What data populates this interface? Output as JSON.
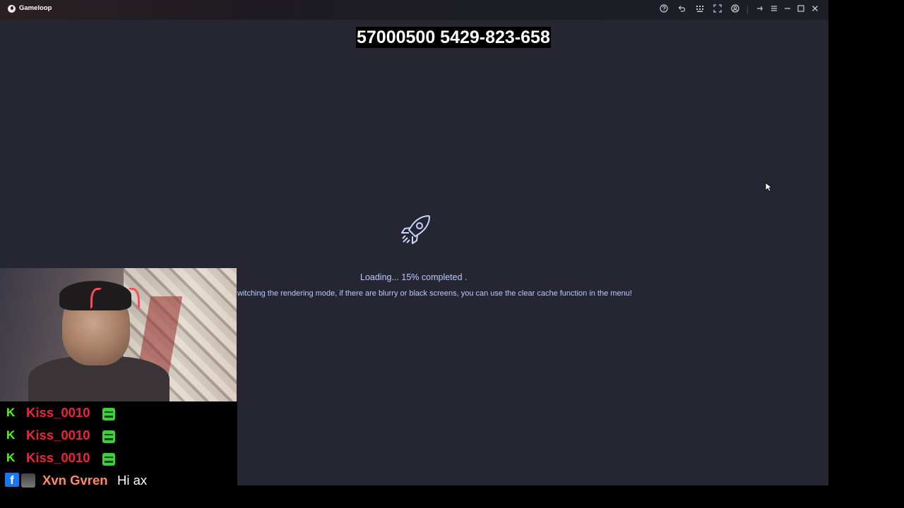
{
  "window": {
    "title": "Gameloop",
    "toolbar_icons": [
      "help-icon",
      "undo-icon",
      "keymap-icon",
      "fullscreen-icon",
      "account-icon",
      "pin-icon",
      "menu-icon",
      "minimize-icon",
      "maximize-icon",
      "close-icon"
    ]
  },
  "overlay": {
    "stream_number": "57000500 5429-823-658"
  },
  "loading": {
    "status": "Loading... 15% completed .",
    "progress_percent": 15,
    "tip": "witching the rendering mode, if there are blurry or black screens, you can use the clear cache function in the menu!"
  },
  "chat": {
    "messages": [
      {
        "platform": "kick",
        "user": "Kiss_0010",
        "text": "",
        "emote": "green-face-emote"
      },
      {
        "platform": "kick",
        "user": "Kiss_0010",
        "text": "",
        "emote": "green-face-emote"
      },
      {
        "platform": "kick",
        "user": "Kiss_0010",
        "text": "",
        "emote": "green-face-emote"
      },
      {
        "platform": "facebook",
        "user": "Xvn Gvren",
        "text": "Hi ax"
      }
    ],
    "kick_glyph": "K",
    "facebook_glyph": "f"
  },
  "colors": {
    "app_bg": "#252632",
    "accent_text": "#b9c8ff",
    "kick": "#53fc18",
    "chat_user": "#f0233b",
    "fb_user": "#ff8a6a"
  }
}
